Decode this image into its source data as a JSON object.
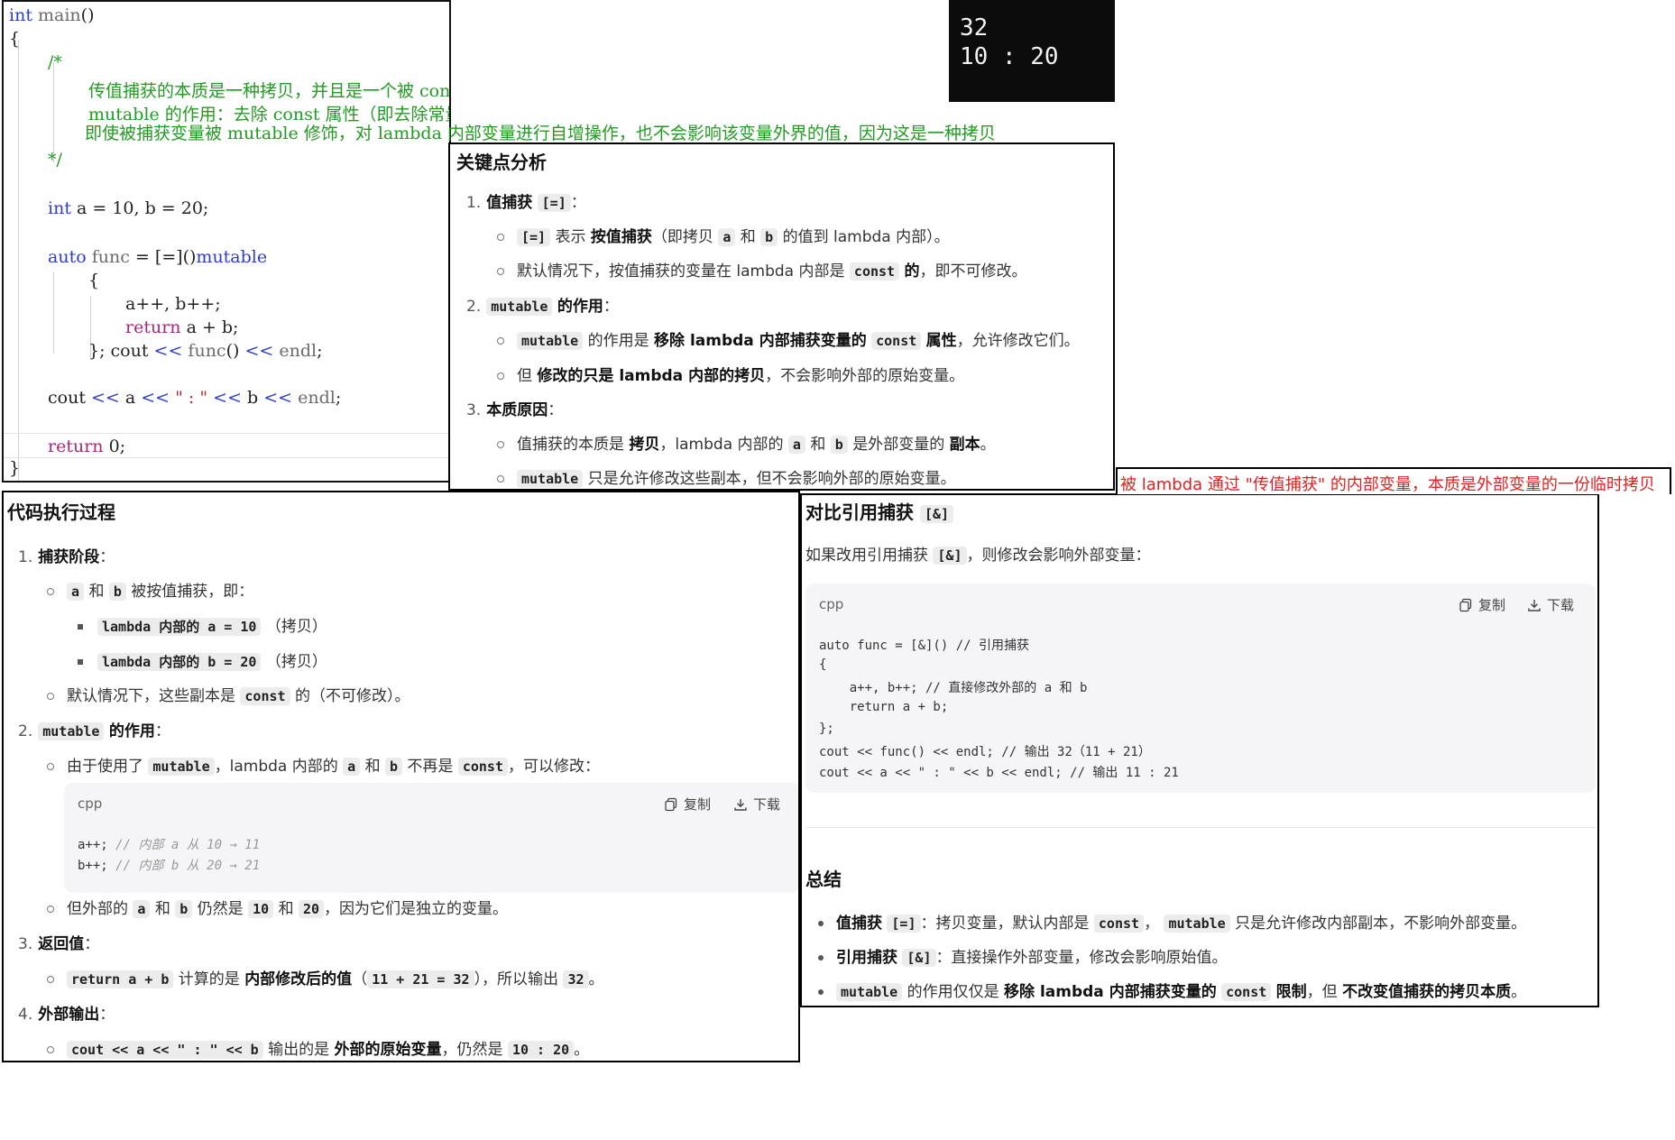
{
  "editor": {
    "lines": [
      "int main()",
      "{",
      "/*",
      "传值捕获的本质是一种拷贝，并且是一个被 const 修饰的变量",
      "mutable 的作用：去除 const 属性（即去除常量性）",
      "即使被捕获变量被 mutable 修饰，对 lambda 内部变量进行自增操作，也不会影响该变量外界的值，因为这是一种拷贝",
      "*/",
      "int a = 10, b = 20;",
      "auto func = [=]()mutable",
      "{",
      "a++, b++;",
      "return a + b;",
      "}; cout << func() << endl;",
      "cout << a << \" : \" << b << endl;",
      "return 0;",
      "}"
    ]
  },
  "console": {
    "lines": [
      "32",
      "10 : 20"
    ]
  },
  "red_note": "被 lambda 通过 \"传值捕获\" 的内部变量，本质是外部变量的一份临时拷贝",
  "key_points": {
    "title": "关键点分析",
    "items": [
      {
        "num": "1.",
        "title": "值捕获",
        "code": "[=]",
        "subs": [
          {
            "code1": "[=]",
            "t1": "表示",
            "b1": "按值捕获",
            "t2": "（即拷贝",
            "code2": "a",
            "t3": "和",
            "code3": "b",
            "t4": "的值到 lambda 内部）。"
          },
          {
            "t1": "默认情况下，按值捕获的变量在 lambda 内部是",
            "code1": "const",
            "b1": "的",
            "t2": "，即不可修改。"
          }
        ]
      },
      {
        "num": "2.",
        "code": "mutable",
        "title": "的作用",
        "subs": [
          {
            "code1": "mutable",
            "t1": "的作用是",
            "b1": "移除 lambda 内部捕获变量的",
            "code2": "const",
            "b2": "属性",
            "t2": "，允许修改它们。"
          },
          {
            "t1": "但",
            "b1": "修改的只是 lambda 内部的拷贝",
            "t2": "，不会影响外部的原始变量。"
          }
        ]
      },
      {
        "num": "3.",
        "title": "本质原因",
        "subs": [
          {
            "t1": "值捕获的本质是",
            "b1": "拷贝",
            "t2": "，lambda 内部的",
            "code1": "a",
            "t3": "和",
            "code2": "b",
            "t4": "是外部变量的",
            "b2": "副本",
            "t5": "。"
          },
          {
            "code1": "mutable",
            "t1": "只是允许修改这些副本，但不会影响外部的原始变量。"
          }
        ]
      }
    ]
  },
  "exec": {
    "title": "代码执行过程",
    "s1": {
      "num": "1.",
      "title": "捕获阶段",
      "l1": {
        "code1": "a",
        "t1": "和",
        "code2": "b",
        "t2": "被按值捕获，即："
      },
      "l2": {
        "code1": "lambda 内部的 a = 10",
        "t1": "（拷贝）"
      },
      "l3": {
        "code1": "lambda 内部的 b = 20",
        "t1": "（拷贝）"
      },
      "l4": {
        "t1": "默认情况下，这些副本是",
        "code1": "const",
        "t2": "的（不可修改）。"
      }
    },
    "s2": {
      "num": "2.",
      "code": "mutable",
      "title": "的作用",
      "l1": {
        "t1": "由于使用了",
        "code1": "mutable",
        "t2": "，lambda 内部的",
        "code2": "a",
        "t3": "和",
        "code3": "b",
        "t4": "不再是",
        "code4": "const",
        "t5": "，可以修改："
      },
      "box": {
        "lang": "cpp",
        "copy": "复制",
        "download": "下载",
        "lines": [
          {
            "code": "a++;",
            "cmt": "// 内部 a 从 10 → 11"
          },
          {
            "code": "b++;",
            "cmt": "// 内部 b 从 20 → 21"
          }
        ]
      },
      "l2": {
        "t1": "但外部的",
        "code1": "a",
        "t2": "和",
        "code2": "b",
        "t3": "仍然是",
        "code3": "10",
        "t4": "和",
        "code4": "20",
        "t5": "，因为它们是独立的变量。"
      }
    },
    "s3": {
      "num": "3.",
      "title": "返回值",
      "l1": {
        "code1": "return a + b",
        "t1": "计算的是",
        "b1": "内部修改后的值",
        "t2": "（",
        "code2": "11 + 21 = 32",
        "t3": "），所以输出",
        "code3": "32",
        "t4": "。"
      }
    },
    "s4": {
      "num": "4.",
      "title": "外部输出",
      "l1": {
        "code1": "cout << a << \" : \" << b",
        "t1": "输出的是",
        "b1": "外部的原始变量",
        "t2": "，仍然是",
        "code2": "10 : 20",
        "t3": "。"
      }
    }
  },
  "compare": {
    "title": "对比引用捕获",
    "title_code": "[&]",
    "intro": {
      "t1": "如果改用引用捕获",
      "code1": "[&]",
      "t2": "，则修改会影响外部变量："
    },
    "box": {
      "lang": "cpp",
      "copy": "复制",
      "download": "下载",
      "lines": [
        "auto func = [&]() // 引用捕获",
        "{",
        "    a++, b++; // 直接修改外部的 a 和 b",
        "    return a + b;",
        "};",
        "cout << func() << endl; // 输出 32（11 + 21）",
        "cout << a << \" : \" << b << endl; // 输出 11 : 21"
      ]
    },
    "summary_title": "总结",
    "summary": [
      {
        "b1": "值捕获",
        "code1": "[=]",
        "t1": "：拷贝变量，默认内部是",
        "code2": "const",
        "t2": "，",
        "code3": "mutable",
        "t3": "只是允许修改内部副本，不影响外部变量。"
      },
      {
        "b1": "引用捕获",
        "code1": "[&]",
        "t1": "：直接操作外部变量，修改会影响原始值。"
      },
      {
        "code1": "mutable",
        "t1": "的作用仅仅是",
        "b1": "移除 lambda 内部捕获变量的",
        "code2": "const",
        "b2": "限制",
        "t2": "，但",
        "b3": "不改变值捕获的拷贝本质",
        "t3": "。"
      }
    ]
  }
}
